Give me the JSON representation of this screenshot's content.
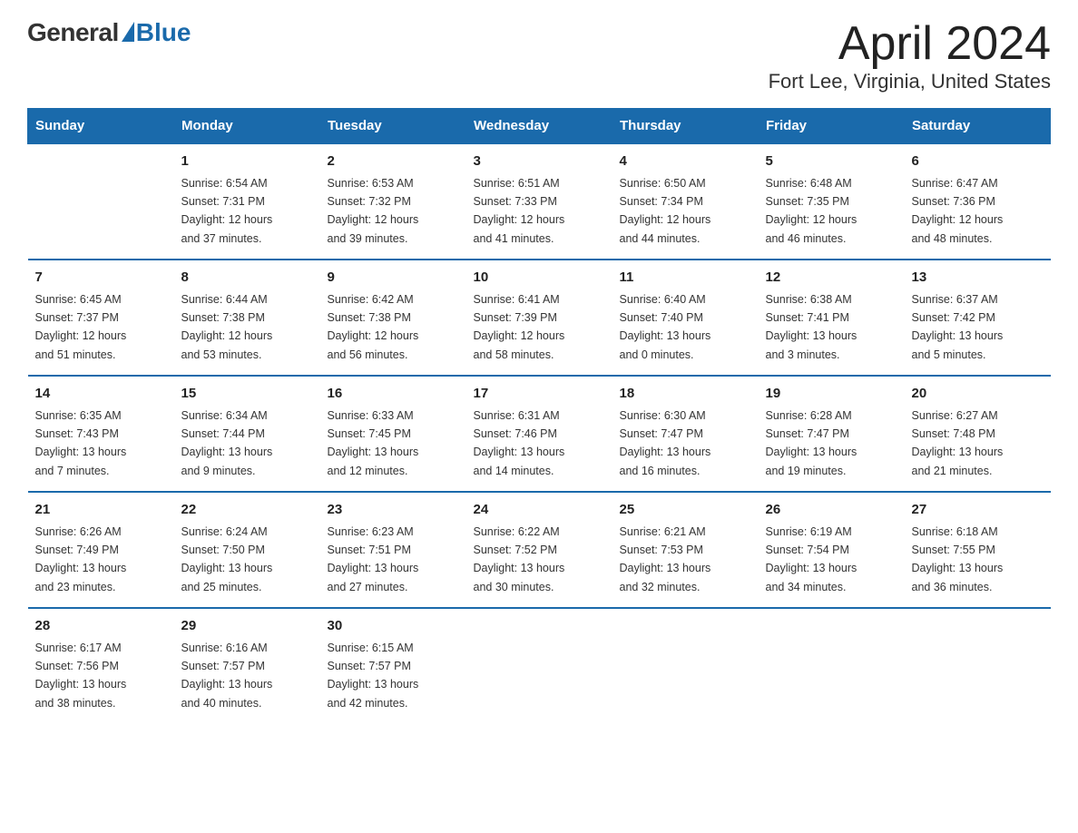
{
  "logo": {
    "general": "General",
    "blue": "Blue",
    "triangle": "▲"
  },
  "title": "April 2024",
  "location": "Fort Lee, Virginia, United States",
  "days_of_week": [
    "Sunday",
    "Monday",
    "Tuesday",
    "Wednesday",
    "Thursday",
    "Friday",
    "Saturday"
  ],
  "weeks": [
    [
      {
        "day": "",
        "info": ""
      },
      {
        "day": "1",
        "info": "Sunrise: 6:54 AM\nSunset: 7:31 PM\nDaylight: 12 hours\nand 37 minutes."
      },
      {
        "day": "2",
        "info": "Sunrise: 6:53 AM\nSunset: 7:32 PM\nDaylight: 12 hours\nand 39 minutes."
      },
      {
        "day": "3",
        "info": "Sunrise: 6:51 AM\nSunset: 7:33 PM\nDaylight: 12 hours\nand 41 minutes."
      },
      {
        "day": "4",
        "info": "Sunrise: 6:50 AM\nSunset: 7:34 PM\nDaylight: 12 hours\nand 44 minutes."
      },
      {
        "day": "5",
        "info": "Sunrise: 6:48 AM\nSunset: 7:35 PM\nDaylight: 12 hours\nand 46 minutes."
      },
      {
        "day": "6",
        "info": "Sunrise: 6:47 AM\nSunset: 7:36 PM\nDaylight: 12 hours\nand 48 minutes."
      }
    ],
    [
      {
        "day": "7",
        "info": "Sunrise: 6:45 AM\nSunset: 7:37 PM\nDaylight: 12 hours\nand 51 minutes."
      },
      {
        "day": "8",
        "info": "Sunrise: 6:44 AM\nSunset: 7:38 PM\nDaylight: 12 hours\nand 53 minutes."
      },
      {
        "day": "9",
        "info": "Sunrise: 6:42 AM\nSunset: 7:38 PM\nDaylight: 12 hours\nand 56 minutes."
      },
      {
        "day": "10",
        "info": "Sunrise: 6:41 AM\nSunset: 7:39 PM\nDaylight: 12 hours\nand 58 minutes."
      },
      {
        "day": "11",
        "info": "Sunrise: 6:40 AM\nSunset: 7:40 PM\nDaylight: 13 hours\nand 0 minutes."
      },
      {
        "day": "12",
        "info": "Sunrise: 6:38 AM\nSunset: 7:41 PM\nDaylight: 13 hours\nand 3 minutes."
      },
      {
        "day": "13",
        "info": "Sunrise: 6:37 AM\nSunset: 7:42 PM\nDaylight: 13 hours\nand 5 minutes."
      }
    ],
    [
      {
        "day": "14",
        "info": "Sunrise: 6:35 AM\nSunset: 7:43 PM\nDaylight: 13 hours\nand 7 minutes."
      },
      {
        "day": "15",
        "info": "Sunrise: 6:34 AM\nSunset: 7:44 PM\nDaylight: 13 hours\nand 9 minutes."
      },
      {
        "day": "16",
        "info": "Sunrise: 6:33 AM\nSunset: 7:45 PM\nDaylight: 13 hours\nand 12 minutes."
      },
      {
        "day": "17",
        "info": "Sunrise: 6:31 AM\nSunset: 7:46 PM\nDaylight: 13 hours\nand 14 minutes."
      },
      {
        "day": "18",
        "info": "Sunrise: 6:30 AM\nSunset: 7:47 PM\nDaylight: 13 hours\nand 16 minutes."
      },
      {
        "day": "19",
        "info": "Sunrise: 6:28 AM\nSunset: 7:47 PM\nDaylight: 13 hours\nand 19 minutes."
      },
      {
        "day": "20",
        "info": "Sunrise: 6:27 AM\nSunset: 7:48 PM\nDaylight: 13 hours\nand 21 minutes."
      }
    ],
    [
      {
        "day": "21",
        "info": "Sunrise: 6:26 AM\nSunset: 7:49 PM\nDaylight: 13 hours\nand 23 minutes."
      },
      {
        "day": "22",
        "info": "Sunrise: 6:24 AM\nSunset: 7:50 PM\nDaylight: 13 hours\nand 25 minutes."
      },
      {
        "day": "23",
        "info": "Sunrise: 6:23 AM\nSunset: 7:51 PM\nDaylight: 13 hours\nand 27 minutes."
      },
      {
        "day": "24",
        "info": "Sunrise: 6:22 AM\nSunset: 7:52 PM\nDaylight: 13 hours\nand 30 minutes."
      },
      {
        "day": "25",
        "info": "Sunrise: 6:21 AM\nSunset: 7:53 PM\nDaylight: 13 hours\nand 32 minutes."
      },
      {
        "day": "26",
        "info": "Sunrise: 6:19 AM\nSunset: 7:54 PM\nDaylight: 13 hours\nand 34 minutes."
      },
      {
        "day": "27",
        "info": "Sunrise: 6:18 AM\nSunset: 7:55 PM\nDaylight: 13 hours\nand 36 minutes."
      }
    ],
    [
      {
        "day": "28",
        "info": "Sunrise: 6:17 AM\nSunset: 7:56 PM\nDaylight: 13 hours\nand 38 minutes."
      },
      {
        "day": "29",
        "info": "Sunrise: 6:16 AM\nSunset: 7:57 PM\nDaylight: 13 hours\nand 40 minutes."
      },
      {
        "day": "30",
        "info": "Sunrise: 6:15 AM\nSunset: 7:57 PM\nDaylight: 13 hours\nand 42 minutes."
      },
      {
        "day": "",
        "info": ""
      },
      {
        "day": "",
        "info": ""
      },
      {
        "day": "",
        "info": ""
      },
      {
        "day": "",
        "info": ""
      }
    ]
  ]
}
